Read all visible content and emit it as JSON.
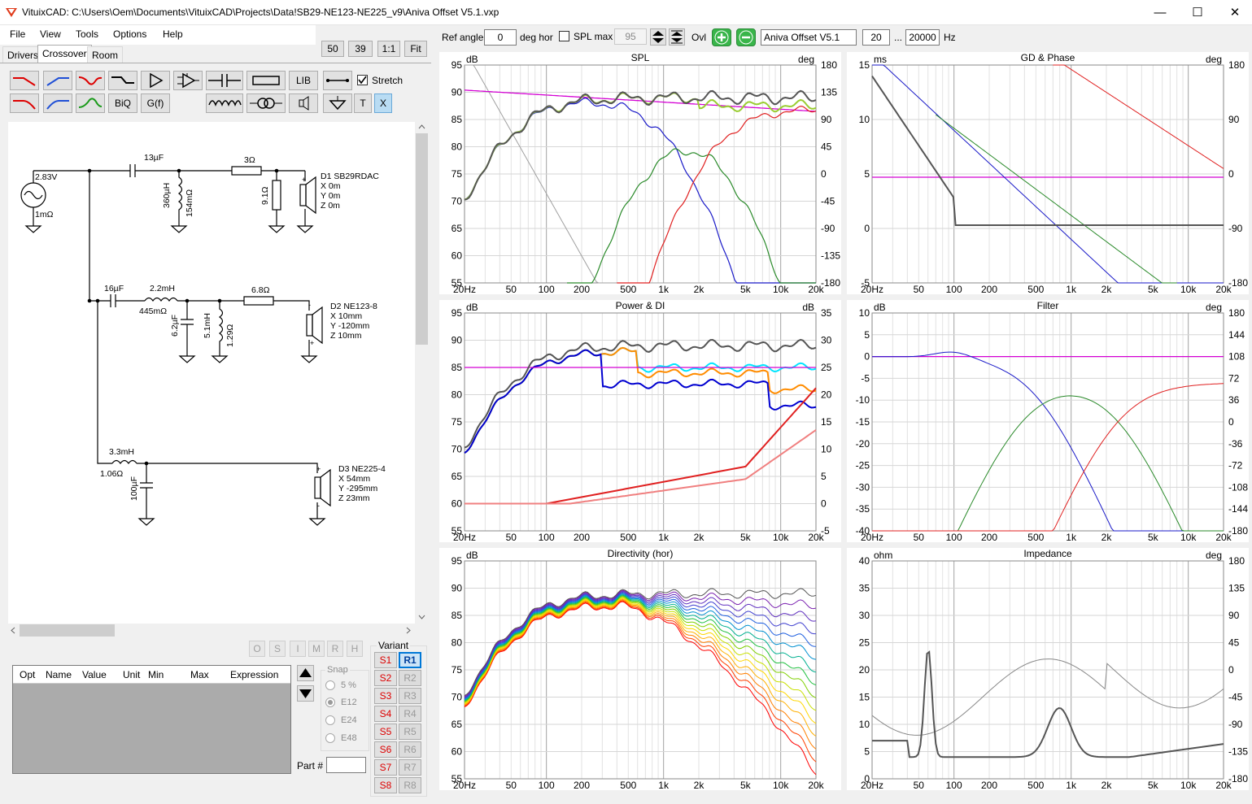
{
  "window": {
    "title": "VituixCAD: C:\\Users\\Oem\\Documents\\VituixCAD\\Projects\\Data!SB29-NE123-NE225_v9\\Aniva Offset V5.1.vxp",
    "min": "—",
    "max": "☐",
    "close": "✕"
  },
  "menu": [
    "File",
    "View",
    "Tools",
    "Options",
    "Help"
  ],
  "tabs": [
    "Drivers",
    "Crossover",
    "Room"
  ],
  "zoom": {
    "z1": "50",
    "z2": "39",
    "one": "1:1",
    "fit": "Fit"
  },
  "toolbar": {
    "biq": "BiQ",
    "gf": "G(f)",
    "lib": "LIB",
    "t": "T",
    "x": "X",
    "stretch": "Stretch"
  },
  "top_controls": {
    "ref_angle_label": "Ref angle",
    "ref_angle": "0",
    "deg_hor": "deg hor",
    "spl_max_label": "SPL max",
    "spl_max": "95",
    "ovl": "Ovl",
    "variant_name": "Aniva Offset V5.1",
    "f_low": "20",
    "dots": "...",
    "f_high": "20000",
    "hz": "Hz"
  },
  "schematic": {
    "source_v": "2.83V",
    "source_r": "1mΩ",
    "c1": "13µF",
    "r1": "3Ω",
    "l1": "360µH",
    "l1r": "154mΩ",
    "r2": "9.1Ω",
    "d1": {
      "name": "D1 SB29RDAC",
      "x": "X 0m",
      "y": "Y 0m",
      "z": "Z 0m"
    },
    "c2": "16µF",
    "l2": "2.2mH",
    "l2r": "445mΩ",
    "c3": "6.2µF",
    "l3": "5.1mH",
    "l3r": "1.29Ω",
    "r3": "6.8Ω",
    "d2": {
      "name": "D2 NE123-8",
      "x": "X 10mm",
      "y": "Y -120mm",
      "z": "Z 10mm"
    },
    "l4": "3.3mH",
    "l4r": "1.06Ω",
    "c4": "100µF",
    "d3": {
      "name": "D3 NE225-4",
      "x": "X 54mm",
      "y": "Y -295mm",
      "z": "Z 23mm"
    }
  },
  "optimizer": {
    "buttons": [
      "O",
      "S",
      "I",
      "M",
      "R",
      "H"
    ],
    "columns": [
      "Opt",
      "Name",
      "Value",
      "Unit",
      "Min",
      "Max",
      "Expression"
    ],
    "snap": "Snap",
    "snap_options": [
      "5 %",
      "E12",
      "E24",
      "E48"
    ],
    "part_label": "Part #"
  },
  "variant": {
    "label": "Variant",
    "s": [
      "S1",
      "S2",
      "S3",
      "S4",
      "S5",
      "S6",
      "S7",
      "S8"
    ],
    "r": [
      "R1",
      "R2",
      "R3",
      "R4",
      "R5",
      "R6",
      "R7",
      "R8"
    ]
  },
  "freq_ticks": [
    "20Hz",
    "50",
    "100",
    "200",
    "500",
    "1k",
    "2k",
    "5k",
    "10k",
    "20k"
  ],
  "charts": {
    "spl": {
      "title": "SPL",
      "left_unit": "dB",
      "right_unit": "deg",
      "y": [
        "95",
        "90",
        "85",
        "80",
        "75",
        "70",
        "65",
        "60",
        "55"
      ],
      "yr": [
        "180",
        "135",
        "90",
        "45",
        "0",
        "-45",
        "-90",
        "-135",
        "-180"
      ]
    },
    "gd": {
      "title": "GD & Phase",
      "left_unit": "ms",
      "right_unit": "deg",
      "y": [
        "15",
        "10",
        "5",
        "0",
        "-5"
      ],
      "yr": [
        "180",
        "90",
        "0",
        "-90",
        "-180"
      ]
    },
    "power": {
      "title": "Power & DI",
      "left_unit": "dB",
      "right_unit": "dB",
      "y": [
        "95",
        "90",
        "85",
        "80",
        "75",
        "70",
        "65",
        "60",
        "55"
      ],
      "yr": [
        "35",
        "30",
        "25",
        "20",
        "15",
        "10",
        "5",
        "0",
        "-5"
      ]
    },
    "filter": {
      "title": "Filter",
      "left_unit": "dB",
      "right_unit": "deg",
      "y": [
        "10",
        "5",
        "0",
        "-5",
        "-10",
        "-15",
        "-20",
        "-25",
        "-30",
        "-35",
        "-40"
      ],
      "yr": [
        "180",
        "144",
        "108",
        "72",
        "36",
        "0",
        "-36",
        "-72",
        "-108",
        "-144",
        "-180"
      ]
    },
    "dir": {
      "title": "Directivity (hor)",
      "left_unit": "dB",
      "y": [
        "95",
        "90",
        "85",
        "80",
        "75",
        "70",
        "65",
        "60",
        "55"
      ]
    },
    "imp": {
      "title": "Impedance",
      "left_unit": "ohm",
      "right_unit": "deg",
      "y": [
        "40",
        "35",
        "30",
        "25",
        "20",
        "15",
        "10",
        "5",
        "0"
      ],
      "yr": [
        "180",
        "135",
        "90",
        "45",
        "0",
        "-45",
        "-90",
        "-135",
        "-180"
      ]
    }
  }
}
